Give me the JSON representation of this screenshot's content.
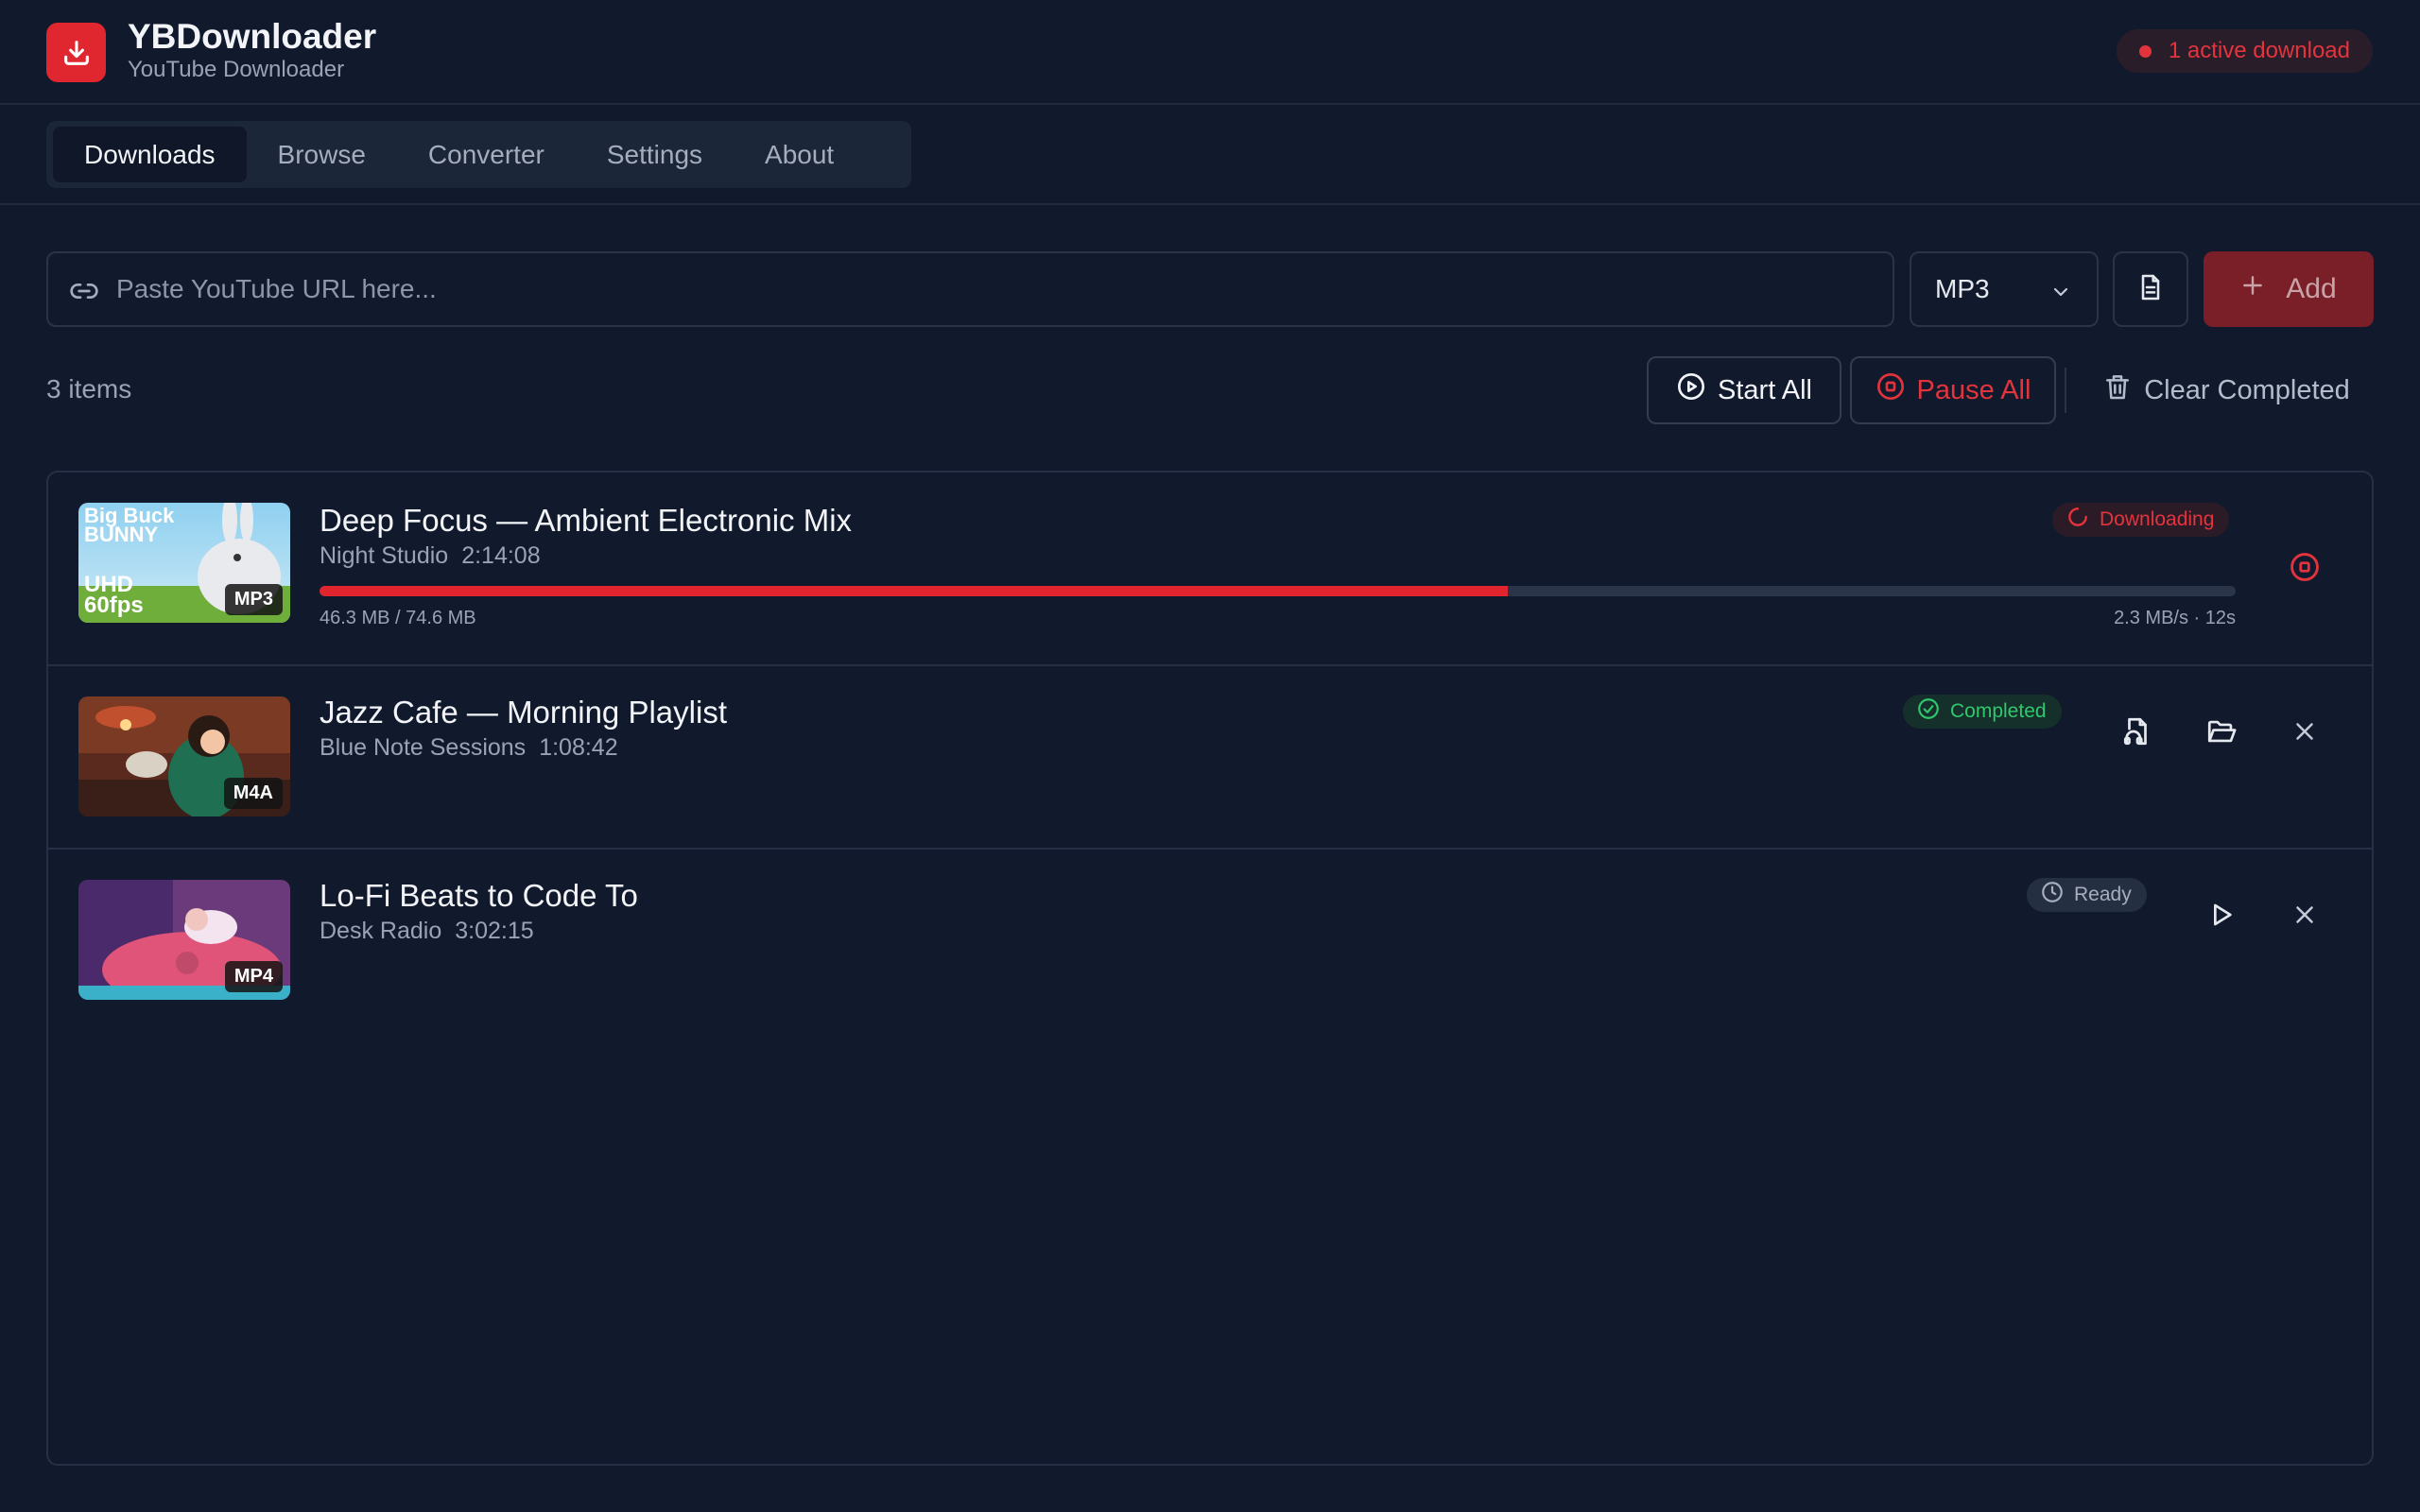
{
  "app": {
    "title": "YBDownloader",
    "subtitle": "YouTube Downloader",
    "active_badge": "1 active download"
  },
  "tabs": [
    {
      "label": "Downloads",
      "active": true
    },
    {
      "label": "Browse",
      "active": false
    },
    {
      "label": "Converter",
      "active": false
    },
    {
      "label": "Settings",
      "active": false
    },
    {
      "label": "About",
      "active": false
    }
  ],
  "url_bar": {
    "placeholder": "Paste YouTube URL here...",
    "value": "",
    "format": "MP3",
    "add_label": "Add"
  },
  "actions": {
    "count": "3 items",
    "start_all": "Start All",
    "pause_all": "Pause All",
    "clear_completed": "Clear Completed"
  },
  "downloads": [
    {
      "title": "Deep Focus — Ambient Electronic Mix",
      "channel": "Night Studio",
      "duration": "2:14:08",
      "format": "MP3",
      "status": "Downloading",
      "progress": 0.62,
      "size": "46.3 MB / 74.6 MB",
      "speed": "2.3 MB/s · 12s",
      "thumb_text": {
        "line1": "Big Buck",
        "line2": "BUNNY",
        "line3": "UHD",
        "line4": "60fps"
      }
    },
    {
      "title": "Jazz Cafe — Morning Playlist",
      "channel": "Blue Note Sessions",
      "duration": "1:08:42",
      "format": "M4A",
      "status": "Completed"
    },
    {
      "title": "Lo-Fi Beats to Code To",
      "channel": "Desk Radio",
      "duration": "3:02:15",
      "format": "MP4",
      "status": "Ready"
    }
  ],
  "colors": {
    "accent": "#e1252f",
    "background": "#111a2d",
    "completed": "#2fc86d"
  }
}
